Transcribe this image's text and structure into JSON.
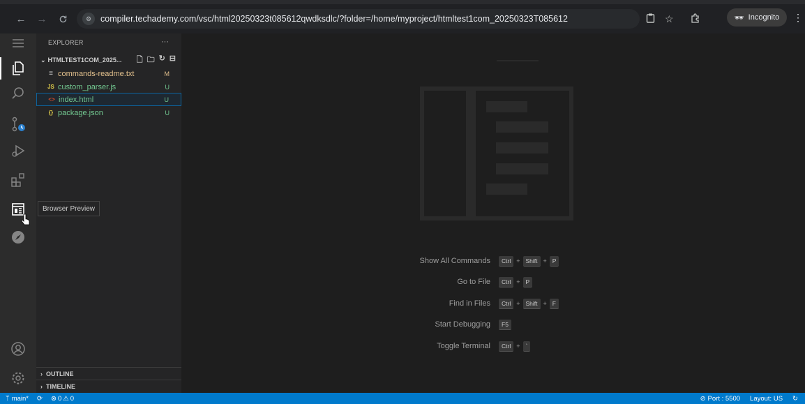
{
  "browser": {
    "url": "compiler.techademy.com/vsc/html20250323t085612qwdksdlc/?folder=/home/myproject/htmltest1com_20250323T085612",
    "incognito_label": "Incognito"
  },
  "explorer": {
    "header": "EXPLORER",
    "more": "···",
    "folder_name": "HTMLTEST1COM_2025...",
    "files": [
      {
        "icon": "≡",
        "name": "commands-readme.txt",
        "status": "M",
        "color": "#e2c08d"
      },
      {
        "icon": "JS",
        "name": "custom_parser.js",
        "status": "U",
        "color": "#73c991"
      },
      {
        "icon": "<>",
        "name": "index.html",
        "status": "U",
        "color": "#73c991"
      },
      {
        "icon": "{}",
        "name": "package.json",
        "status": "U",
        "color": "#73c991"
      }
    ],
    "outline": "OUTLINE",
    "timeline": "TIMELINE"
  },
  "tooltip": "Browser Preview",
  "welcome": {
    "shortcuts": [
      {
        "label": "Show All Commands",
        "keys": [
          "Ctrl",
          "+",
          "Shift",
          "+",
          "P"
        ]
      },
      {
        "label": "Go to File",
        "keys": [
          "Ctrl",
          "+",
          "P"
        ]
      },
      {
        "label": "Find in Files",
        "keys": [
          "Ctrl",
          "+",
          "Shift",
          "+",
          "F"
        ]
      },
      {
        "label": "Start Debugging",
        "keys": [
          "F5"
        ]
      },
      {
        "label": "Toggle Terminal",
        "keys": [
          "Ctrl",
          "+",
          "`"
        ]
      }
    ]
  },
  "status": {
    "branch": "main*",
    "errors": "0",
    "warnings": "0",
    "port": "Port : 5500",
    "layout": "Layout: US"
  },
  "colors": {
    "status_bar": "#007acc",
    "activity_bar": "#2c2c2c",
    "sidebar": "#252526",
    "editor": "#1e1e1e"
  }
}
